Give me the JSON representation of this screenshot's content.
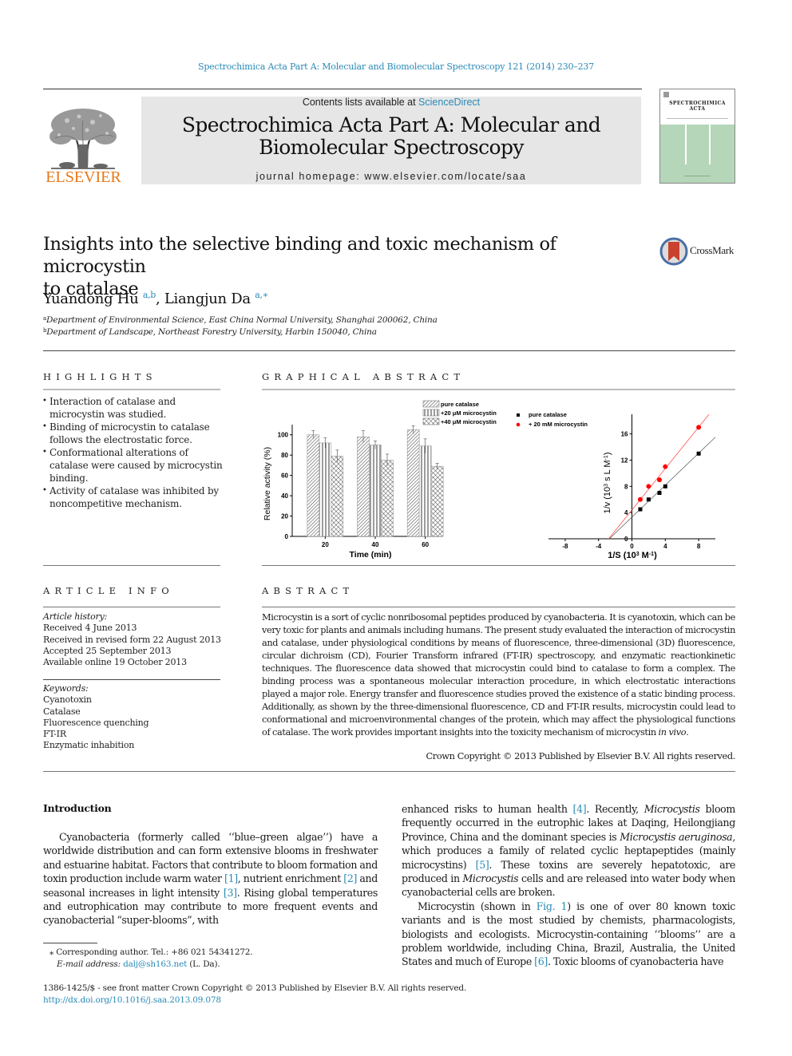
{
  "header": {
    "journal_ref": "Spectrochimica Acta Part A: Molecular and Biomolecular Spectroscopy 121 (2014) 230–237",
    "contents_prefix": "Contents lists available at ",
    "contents_link": "ScienceDirect",
    "journal_title_line1": "Spectrochimica Acta Part A: Molecular and",
    "journal_title_line2": "Biomolecular Spectroscopy",
    "homepage_prefix": "journal homepage: ",
    "homepage_url": "www.elsevier.com/locate/saa",
    "publisher_logo_text": "ELSEVIER",
    "cover_title_line1": "SPECTROCHIMICA",
    "cover_title_line2": "ACTA",
    "colors": {
      "link": "#2a8ab6",
      "elsevier_orange": "#e67817",
      "banner_bg": "#e6e6e6",
      "cover_green": "#b5d6b8"
    }
  },
  "article": {
    "title_line1": "Insights into the selective binding and toxic mechanism of microcystin",
    "title_line2": "to catalase",
    "crossmark_label": "CrossMark",
    "authors": [
      {
        "name": "Yuandong Hu",
        "sup": "a,b"
      },
      {
        "name": "Liangjun Da",
        "sup": "a,∗"
      }
    ],
    "author_separator": ", ",
    "affiliations": [
      {
        "mark": "a",
        "text": "Department of Environmental Science, East China Normal University, Shanghai 200062, China"
      },
      {
        "mark": "b",
        "text": "Department of Landscape, Northeast Forestry University, Harbin 150040, China"
      }
    ]
  },
  "highlights": {
    "heading": "HIGHLIGHTS",
    "items": [
      "Interaction of catalase and microcystin was studied.",
      "Binding of microcystin to catalase follows the electrostatic force.",
      "Conformational alterations of catalase were caused by microcystin binding.",
      "Activity of catalase was inhibited by noncompetitive mechanism."
    ]
  },
  "graphical_abstract": {
    "heading": "GRAPHICAL ABSTRACT"
  },
  "chart_data": [
    {
      "type": "bar",
      "title": "",
      "xlabel": "Time (min)",
      "ylabel": "Relative activity (%)",
      "categories": [
        "20",
        "40",
        "60"
      ],
      "ylim": [
        0,
        110
      ],
      "yticks": [
        0,
        20,
        40,
        60,
        80,
        100
      ],
      "grid": false,
      "legend_position": "top-right",
      "series": [
        {
          "name": "pure catalase",
          "pattern": "diagonal",
          "values": [
            100,
            98,
            105
          ],
          "errors": [
            4,
            6,
            4
          ]
        },
        {
          "name": "+20 μM microcystin",
          "pattern": "vertical",
          "values": [
            92,
            90,
            89
          ],
          "errors": [
            5,
            4,
            7
          ]
        },
        {
          "name": "+40 μM microcystin",
          "pattern": "crosshatch",
          "values": [
            79,
            75,
            69
          ],
          "errors": [
            6,
            6,
            3
          ]
        }
      ]
    },
    {
      "type": "scatter",
      "title": "",
      "xlabel": "1/S (10³ M⁻¹)",
      "ylabel": "1/v (10³ s L M⁻¹)",
      "xlim": [
        -10,
        10
      ],
      "ylim": [
        0,
        19
      ],
      "xticks": [
        -8,
        -4,
        0,
        4,
        8
      ],
      "yticks": [
        0,
        4,
        8,
        12,
        16
      ],
      "grid": false,
      "legend_position": "top-left",
      "series": [
        {
          "name": "pure catalase",
          "marker": "square",
          "color": "#000000",
          "x": [
            1,
            2,
            3.3,
            4,
            8
          ],
          "y": [
            4.5,
            6,
            7,
            8,
            13
          ],
          "fit": {
            "slope": 1.22,
            "intercept": 3.3
          }
        },
        {
          "name": "+ 20 mM microcystin",
          "marker": "circle",
          "color": "#ff0000",
          "x": [
            1,
            2,
            3.3,
            4,
            8
          ],
          "y": [
            6,
            8,
            9,
            11,
            17
          ],
          "fit": {
            "slope": 1.58,
            "intercept": 4.4
          }
        }
      ]
    }
  ],
  "article_info": {
    "heading": "ARTICLE INFO",
    "history_label": "Article history:",
    "history": [
      "Received 4 June 2013",
      "Received in revised form 22 August 2013",
      "Accepted 25 September 2013",
      "Available online 19 October 2013"
    ],
    "keywords_label": "Keywords:",
    "keywords": [
      "Cyanotoxin",
      "Catalase",
      "Fluorescence quenching",
      "FT-IR",
      "Enzymatic inhabition"
    ]
  },
  "abstract": {
    "heading": "ABSTRACT",
    "text": "Microcystin is a sort of cyclic nonribosomal peptides produced by cyanobacteria. It is cyanotoxin, which can be very toxic for plants and animals including humans. The present study evaluated the interaction of microcystin and catalase, under physiological conditions by means of fluorescence, three-dimensional (3D) fluorescence, circular dichroism (CD), Fourier Transform infrared (FT-IR) spectroscopy, and enzymatic reactionkinetic techniques. The fluorescence data showed that microcystin could bind to catalase to form a complex. The binding process was a spontaneous molecular interaction procedure, in which electrostatic interactions played a major role. Energy transfer and fluorescence studies proved the existence of a static binding process. Additionally, as shown by the three-dimensional fluorescence, CD and FT-IR results, microcystin could lead to conformational and microenvironmental changes of the protein, which may affect the physiological functions of catalase. The work provides important insights into the toxicity mechanism of microcystin ",
    "text_italic_end": "in vivo",
    "text_end": ".",
    "copyright": "Crown Copyright © 2013 Published by Elsevier B.V. All rights reserved."
  },
  "introduction": {
    "heading": "Introduction",
    "col1": {
      "p1_a": "Cyanobacteria (formerly called ‘‘blue–green algae’’) have a worldwide distribution and can form extensive blooms in freshwater and estuarine habitat. Factors that contribute to bloom formation and toxin production include warm water ",
      "ref1": "[1]",
      "p1_b": ", nutrient enrichment ",
      "ref2": "[2]",
      "p1_c": " and seasonal increases in light intensity ",
      "ref3": "[3]",
      "p1_d": ". Rising global temperatures and eutrophication may contribute to more frequent events and cyanobacterial “super-blooms”, with"
    },
    "col2": {
      "p1_a": "enhanced risks to human health ",
      "ref4": "[4]",
      "p1_b": ". Recently, ",
      "i1": "Microcystis",
      "p1_c": " bloom frequently occurred in the eutrophic lakes at Daqing, Heilongjiang Province, China and the dominant species is ",
      "i2": "Microcystis aeruginosa",
      "p1_d": ", which produces a family of related cyclic heptapeptides (mainly microcystins) ",
      "ref5": "[5]",
      "p1_e": ". These toxins are severely hepatotoxic, are produced in ",
      "i3": "Microcystis",
      "p1_f": " cells and are released into water body when cyanobacterial cells are broken.",
      "p2_a": "Microcystin (shown in ",
      "fig1": "Fig. 1",
      "p2_b": ") is one of over 80 known toxic variants and is the most studied by chemists, pharmacologists, biologists and ecologists. Microcystin-containing ‘‘blooms’’ are a problem worldwide, including China, Brazil, Australia, the United States and much of Europe ",
      "ref6": "[6]",
      "p2_c": ". Toxic blooms of cyanobacteria have"
    }
  },
  "footnote": {
    "star": "⁎",
    "corresponding": "Corresponding author. Tel.: +86 021 54341272.",
    "email_label": "E-mail address:",
    "email": "dalj@sh163.net",
    "email_suffix": " (L. Da)."
  },
  "bottom": {
    "issn_line": "1386-1425/$ - see front matter Crown Copyright © 2013 Published by Elsevier B.V. All rights reserved.",
    "doi": "http://dx.doi.org/10.1016/j.saa.2013.09.078"
  }
}
